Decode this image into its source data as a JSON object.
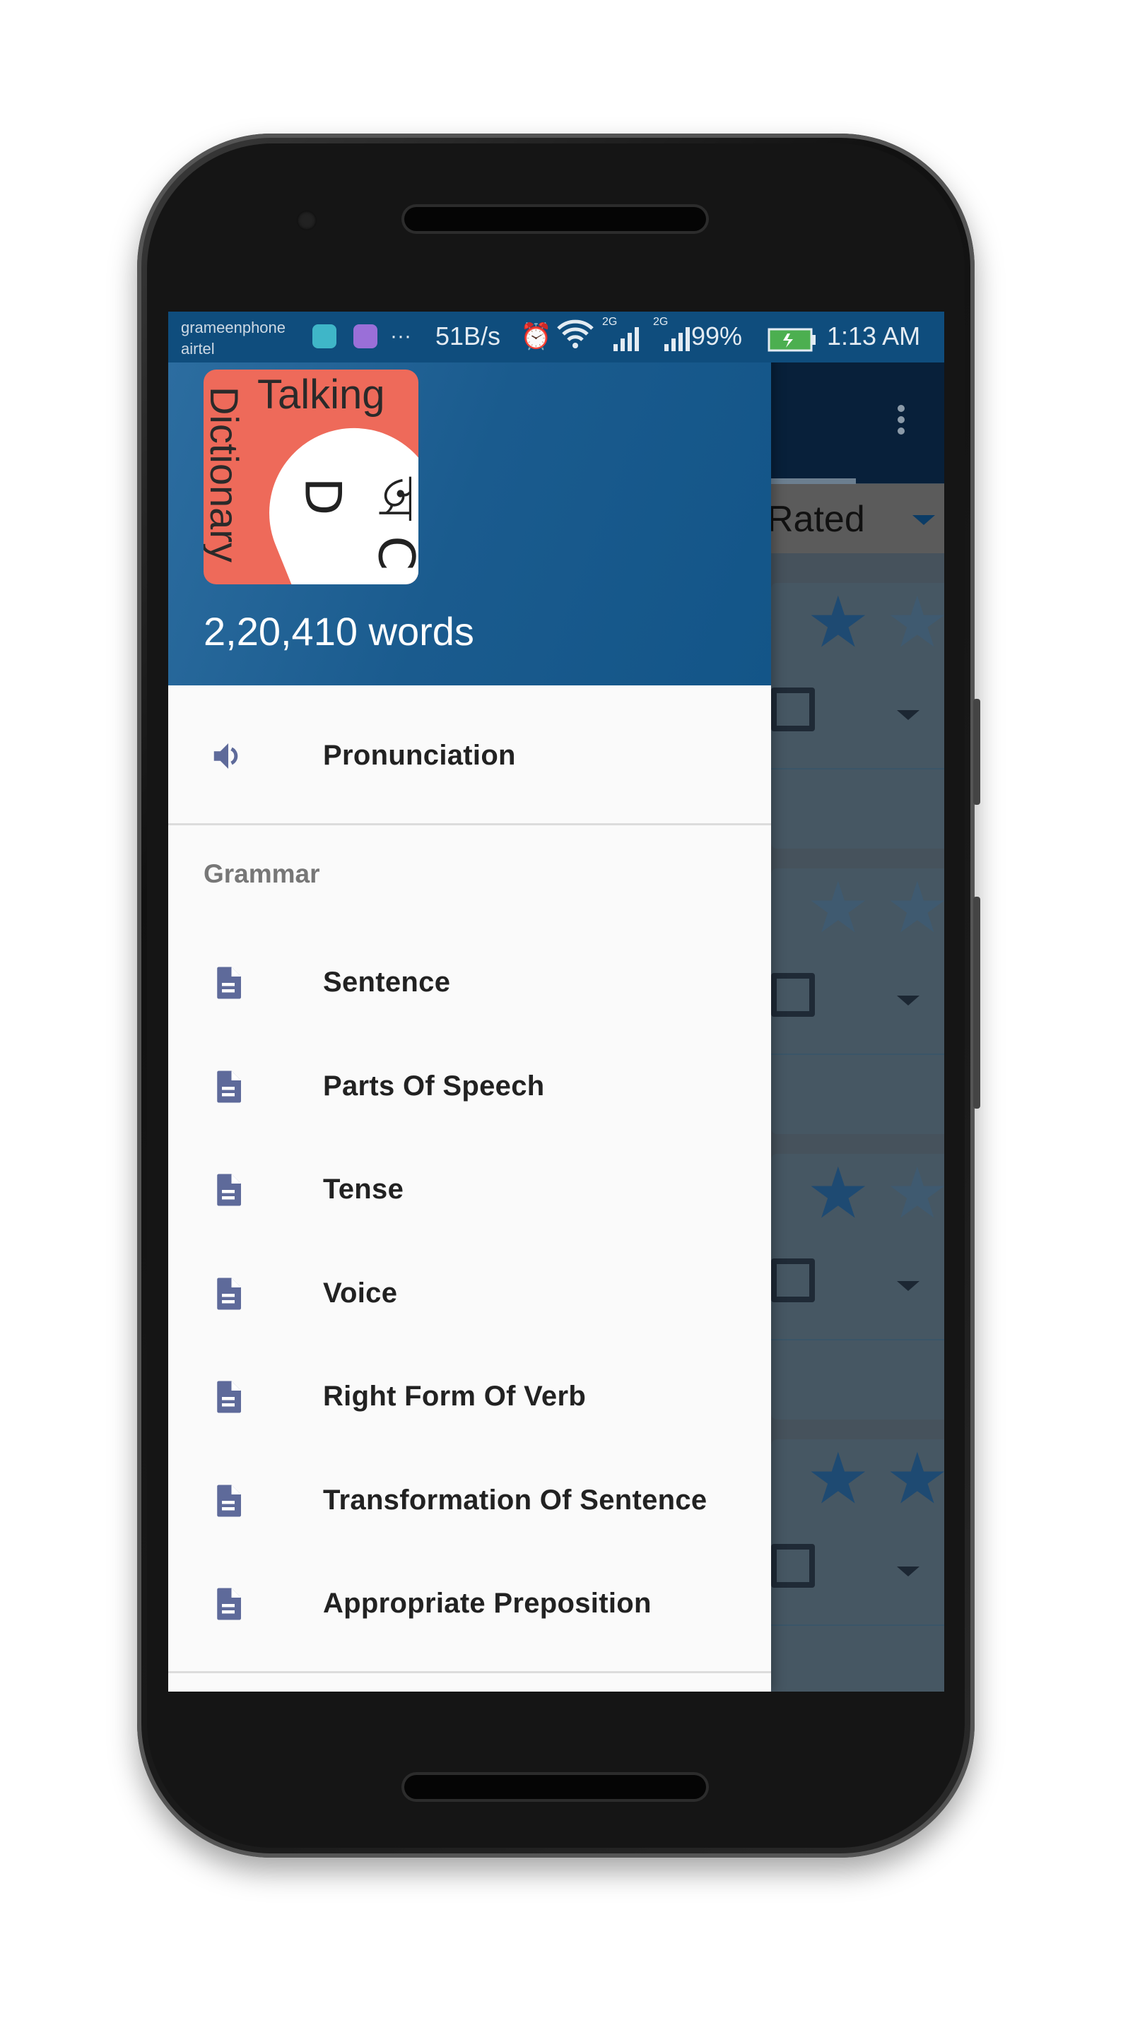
{
  "status_bar": {
    "carrier1": "grameenphone",
    "carrier2": "airtel",
    "more": "···",
    "net_speed": "51B/s",
    "signal1_label": "2G",
    "signal2_label": "2G",
    "battery": "99%",
    "time": "1:13 AM",
    "icons": [
      "android-notification-icon",
      "gallery-notification-icon",
      "alarm-icon",
      "wifi-icon",
      "signal-icon",
      "signal-icon",
      "battery-charging-icon"
    ]
  },
  "drawer": {
    "logo": {
      "line1": "Talking",
      "line2": "Dictionary",
      "glyph": "অ C D"
    },
    "word_count": "2,20,410 words",
    "items": [
      {
        "label": "Pronunciation",
        "icon": "speaker-icon"
      }
    ],
    "section_title": "Grammar",
    "grammar_items": [
      {
        "label": "Sentence",
        "icon": "document-icon"
      },
      {
        "label": "Parts Of Speech",
        "icon": "document-icon"
      },
      {
        "label": "Tense",
        "icon": "document-icon"
      },
      {
        "label": "Voice",
        "icon": "document-icon"
      },
      {
        "label": "Right Form Of Verb",
        "icon": "document-icon"
      },
      {
        "label": "Transformation Of Sentence",
        "icon": "document-icon"
      },
      {
        "label": "Appropriate Preposition",
        "icon": "document-icon"
      }
    ]
  },
  "background": {
    "filter_label": "Rated",
    "cards": [
      {
        "stars_filled": [
          true,
          false
        ]
      },
      {
        "stars_filled": [
          false,
          false
        ]
      },
      {
        "stars_filled": [
          true,
          false
        ]
      },
      {
        "stars_filled": [
          true,
          true
        ]
      }
    ]
  },
  "colors": {
    "header": "#135588",
    "icon": "#5e6a9a",
    "logo": "#ee6a5a",
    "battery": "#4caf50"
  }
}
